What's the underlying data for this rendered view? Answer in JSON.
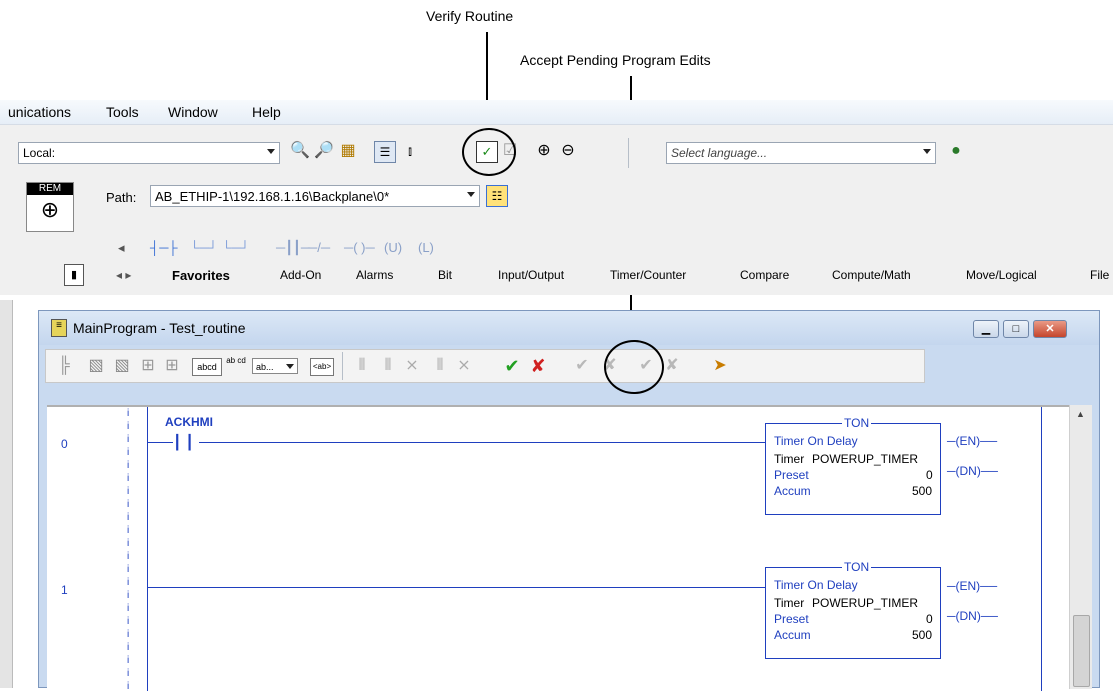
{
  "callouts": {
    "verify": "Verify Routine",
    "accept": "Accept Pending Program Edits"
  },
  "menu": [
    "unications",
    "Tools",
    "Window",
    "Help"
  ],
  "toolbar": {
    "comm_path_combo": "Local:",
    "language_placeholder": "Select language...",
    "rem_label": "REM",
    "path_label": "Path:",
    "path_value": "AB_ETHIP-1\\192.168.1.16\\Backplane\\0*"
  },
  "instruction_tabs": [
    "Favorites",
    "Add-On",
    "Alarms",
    "Bit",
    "Input/Output",
    "Timer/Counter",
    "Compare",
    "Compute/Math",
    "Move/Logical",
    "File"
  ],
  "window": {
    "title": "MainProgram - Test_routine",
    "toolbar_labels": {
      "abcd": "abcd",
      "ab_cd": "ab cd",
      "ab_dropdown": "ab...",
      "ab_tag": "<ab>"
    }
  },
  "rungs": [
    {
      "number": "0",
      "contact_tag": "ACKHMI",
      "instruction": "TON",
      "box_title": "Timer On Delay",
      "timer_label": "Timer",
      "timer_tag": "POWERUP_TIMER",
      "preset_label": "Preset",
      "preset_value": "0",
      "accum_label": "Accum",
      "accum_value": "500",
      "out_en": "EN",
      "out_dn": "DN"
    },
    {
      "number": "1",
      "contact_tag": "",
      "instruction": "TON",
      "box_title": "Timer On Delay",
      "timer_label": "Timer",
      "timer_tag": "POWERUP_TIMER",
      "preset_label": "Preset",
      "preset_value": "0",
      "accum_label": "Accum",
      "accum_value": "500",
      "out_en": "EN",
      "out_dn": "DN"
    }
  ],
  "colors": {
    "ladder": "#1f3fbf",
    "accent": "#3a6fd4"
  }
}
